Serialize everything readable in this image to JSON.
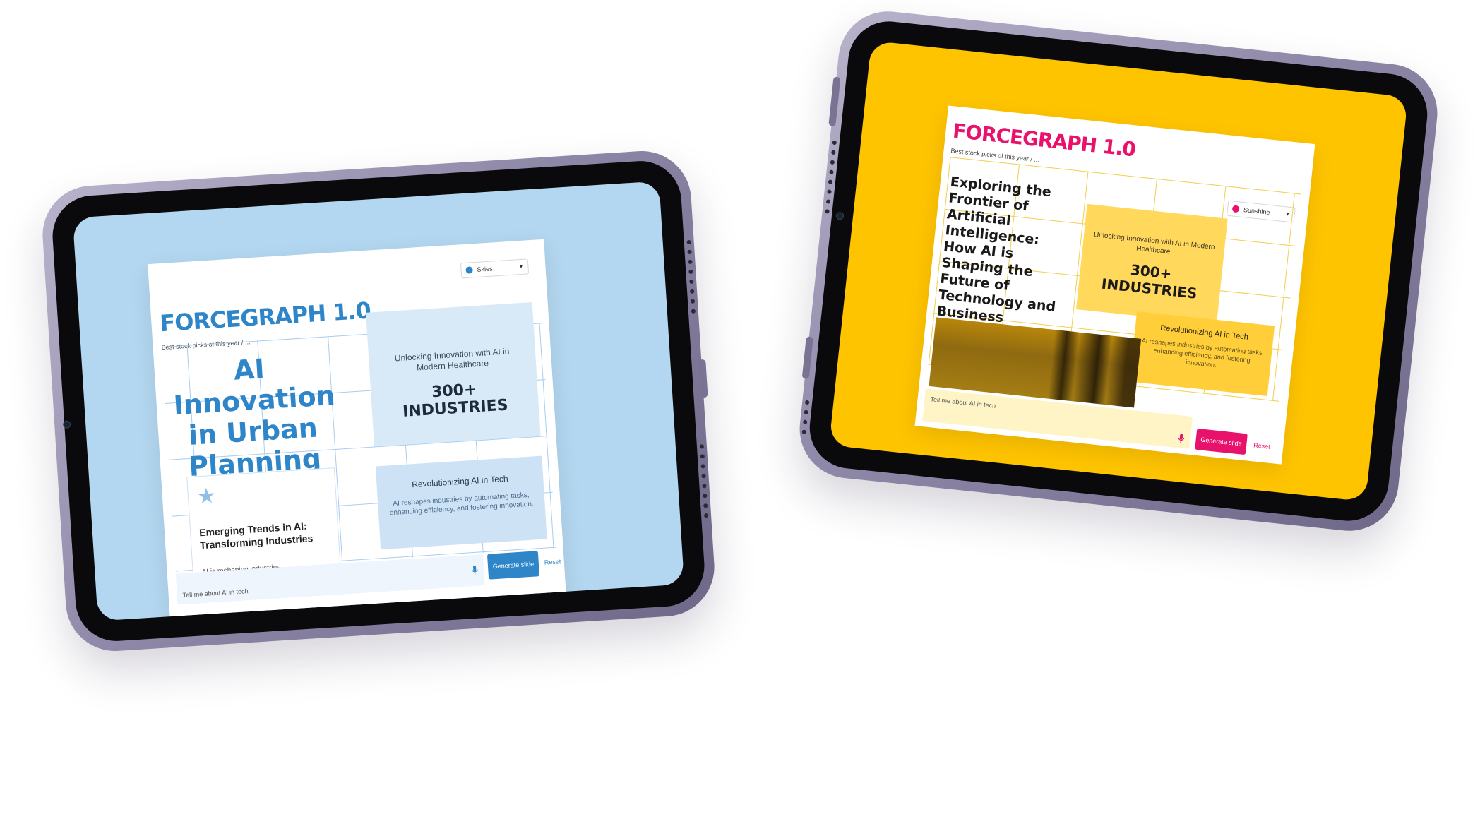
{
  "left_device": {
    "app": {
      "logo": "FORCEGRAPH 1.0",
      "subtitle": "Best stock picks of this year / ...",
      "theme": {
        "label": "Skies",
        "color": "#2e86c8"
      },
      "slide": {
        "title": "AI Innovation in Urban Planning",
        "stat_box": {
          "caption": "Unlocking Innovation with AI in Modern Healthcare",
          "value": "300+ INDUSTRIES"
        },
        "card": {
          "title": "Emerging Trends in AI: Transforming Industries",
          "body": "AI is reshaping industries."
        },
        "tech_box": {
          "title": "Revolutionizing AI in Tech",
          "body": "AI reshapes industries by automating tasks, enhancing efficiency, and fostering innovation."
        }
      },
      "prompt": {
        "placeholder": "Tell me about AI in tech"
      },
      "generate_label": "Generate slide",
      "reset_label": "Reset"
    },
    "colors": {
      "screen_bg": "#b3d7f0",
      "accent": "#2e86c8",
      "grid": "#a9cdef",
      "box": "#d8eaf8"
    }
  },
  "right_device": {
    "app": {
      "logo": "FORCEGRAPH 1.0",
      "subtitle": "Best stock picks of this year / ...",
      "theme": {
        "label": "Sunshine",
        "color": "#e8116b"
      },
      "slide": {
        "title": "Exploring the Frontier of Artificial Intelligence: How AI is Shaping the Future of Technology and Business",
        "stat_box": {
          "caption": "Unlocking Innovation with AI in Modern Healthcare",
          "value": "300+ INDUSTRIES"
        },
        "tech_box": {
          "title": "Revolutionizing AI in Tech",
          "body": "AI reshapes industries by automating tasks, enhancing efficiency, and fostering innovation."
        },
        "image_icon": "rusty-texture-image"
      },
      "prompt": {
        "placeholder": "Tell me about AI in tech"
      },
      "generate_label": "Generate slide",
      "reset_label": "Reset"
    },
    "colors": {
      "screen_bg": "#ffc400",
      "accent": "#e8116b",
      "grid": "#f2cf4a",
      "box": "#ffd85c"
    }
  },
  "icons": {
    "star": "star-icon",
    "mic": "microphone-icon",
    "chevron": "chevron-down-icon"
  }
}
